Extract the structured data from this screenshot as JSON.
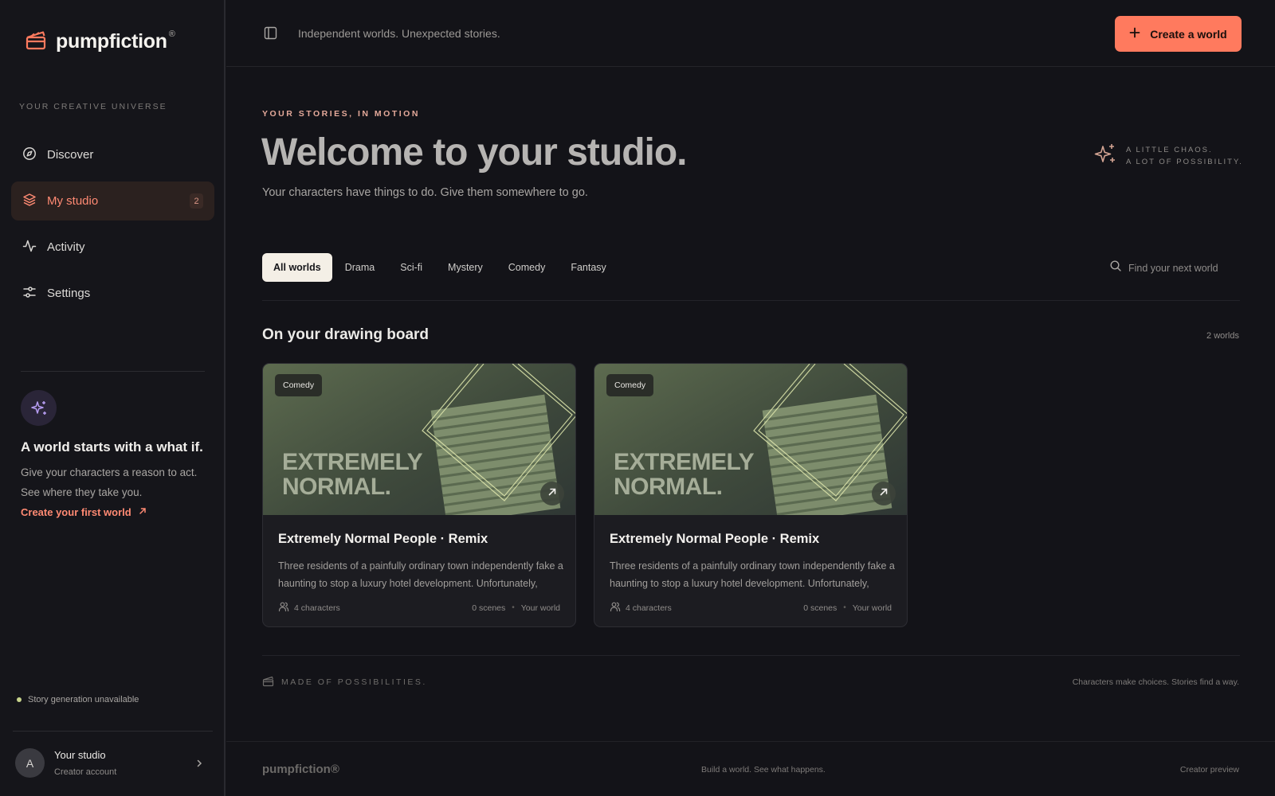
{
  "brand": {
    "name": "pumpfiction",
    "reg": "®",
    "accent": "#ff7a5e"
  },
  "sidebar": {
    "section_label": "YOUR CREATIVE UNIVERSE",
    "items": [
      {
        "label": "Discover",
        "icon": "compass-icon"
      },
      {
        "label": "My studio",
        "icon": "layers-icon",
        "count": "2",
        "active": true
      },
      {
        "label": "Activity",
        "icon": "activity-icon"
      },
      {
        "label": "Settings",
        "icon": "sliders-icon"
      }
    ],
    "promo": {
      "icon": "sparkles-icon",
      "title": "A world starts with a what if.",
      "text": "Give your characters a reason to act. See where they take you.",
      "link": "Create your first world"
    },
    "status": "Story generation unavailable",
    "account": {
      "initial": "A",
      "name": "Your studio",
      "sub": "Creator account"
    }
  },
  "topbar": {
    "tagline": "Independent worlds. Unexpected stories.",
    "create_label": "Create a world"
  },
  "hero": {
    "eyebrow": "YOUR STORIES, IN MOTION",
    "title": "Welcome to your studio.",
    "subtitle": "Your characters have things to do. Give them somewhere to go.",
    "chaos_line1": "A LITTLE CHAOS.",
    "chaos_line2": "A LOT OF POSSIBILITY."
  },
  "filters": {
    "chips": [
      "All worlds",
      "Drama",
      "Sci-fi",
      "Mystery",
      "Comedy",
      "Fantasy"
    ],
    "active": "All worlds",
    "search_placeholder": "Find your next world"
  },
  "section": {
    "title": "On your drawing board",
    "count": "2 worlds"
  },
  "cards": [
    {
      "tag": "Comedy",
      "cover_line1": "EXTREMELY",
      "cover_line2": "NORMAL.",
      "title": "Extremely Normal People · Remix",
      "desc": "Three residents of a painfully ordinary town independently fake a haunting to stop a luxury hotel development. Unfortunately, thei…",
      "characters": "4 characters",
      "scenes": "0 scenes",
      "owner": "Your world"
    },
    {
      "tag": "Comedy",
      "cover_line1": "EXTREMELY",
      "cover_line2": "NORMAL.",
      "title": "Extremely Normal People · Remix",
      "desc": "Three residents of a painfully ordinary town independently fake a haunting to stop a luxury hotel development. Unfortunately, thei…",
      "characters": "4 characters",
      "scenes": "0 scenes",
      "owner": "Your world"
    }
  ],
  "bottom": {
    "made": "MADE OF POSSIBILITIES.",
    "choices": "Characters make choices. Stories find a way."
  },
  "footer": {
    "logo": "pumpfiction®",
    "middle": "Build a world. See what happens.",
    "right": "Creator preview"
  }
}
